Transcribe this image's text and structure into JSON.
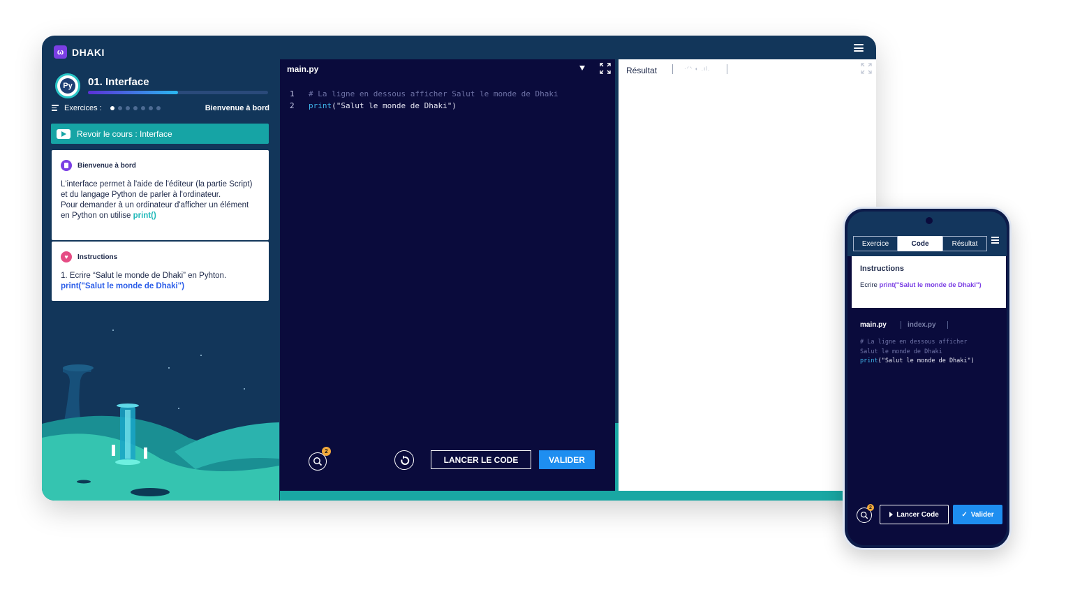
{
  "app": {
    "logo_text": "DHAKI",
    "logo_mark": "ω"
  },
  "course": {
    "icon_text": "Py",
    "title": "01. Interface",
    "progress_percent": 50,
    "exercises_label": "Exercices :",
    "exercise_dots": 7,
    "active_dot": 0,
    "welcome_link": "Bienvenue à bord",
    "review_button": "Revoir le cours : Interface"
  },
  "card_welcome": {
    "title": "Bienvenue à bord",
    "text_1": "L'interface permet à l'aide de l'éditeur (la partie Script) et du langage Python de parler à l'ordinateur.",
    "text_2": "Pour demander à un ordinateur d'afficher un élément en Python on utilise ",
    "code": "print()"
  },
  "card_instructions": {
    "title": "Instructions",
    "text": "1. Ecrire “Salut le monde de Dhaki” en Pyhton.",
    "code": "print(\"Salut le monde de Dhaki\")"
  },
  "editor": {
    "file_name": "main.py",
    "lines": [
      {
        "number": "1",
        "comment": "# La ligne en dessous afficher Salut le monde de Dhaki"
      },
      {
        "number": "2",
        "keyword": "print",
        "rest": "(\"Salut le monde de Dhaki\")"
      }
    ],
    "hint_count": "2",
    "run_button": "LANCER LE CODE",
    "validate_button": "VALIDER"
  },
  "result": {
    "tab_label": "Résultat",
    "faded_label": "·ᐟᐠ ◐ .ıl."
  },
  "mobile": {
    "tabs": [
      "Exercice",
      "Code",
      "Résultat"
    ],
    "active_tab": 1,
    "instructions_title": "Instructions",
    "instructions_text": "Ecrire ",
    "instructions_code": "print(\"Salut le monde de Dhaki\")",
    "files": [
      "main.py",
      "index.py"
    ],
    "code_comment": "# La ligne en dessous afficher\nSalut le monde de Dhaki",
    "code_keyword": "print",
    "code_rest": "(\"Salut le monde de Dhaki\")",
    "hint_count": "2",
    "run_button": "Lancer Code",
    "validate_button": "Valider"
  },
  "colors": {
    "window_bg": "#12365a",
    "editor_bg": "#0a0b3c",
    "teal": "#16a4a5",
    "primary_blue": "#1e8ef0",
    "purple": "#7b3fe4"
  },
  "icons": [
    "menu-icon",
    "python-icon",
    "list-icon",
    "play-icon",
    "document-icon",
    "heart-icon",
    "dropdown-icon",
    "expand-icon",
    "hint-search-icon",
    "reset-icon",
    "check-icon"
  ]
}
